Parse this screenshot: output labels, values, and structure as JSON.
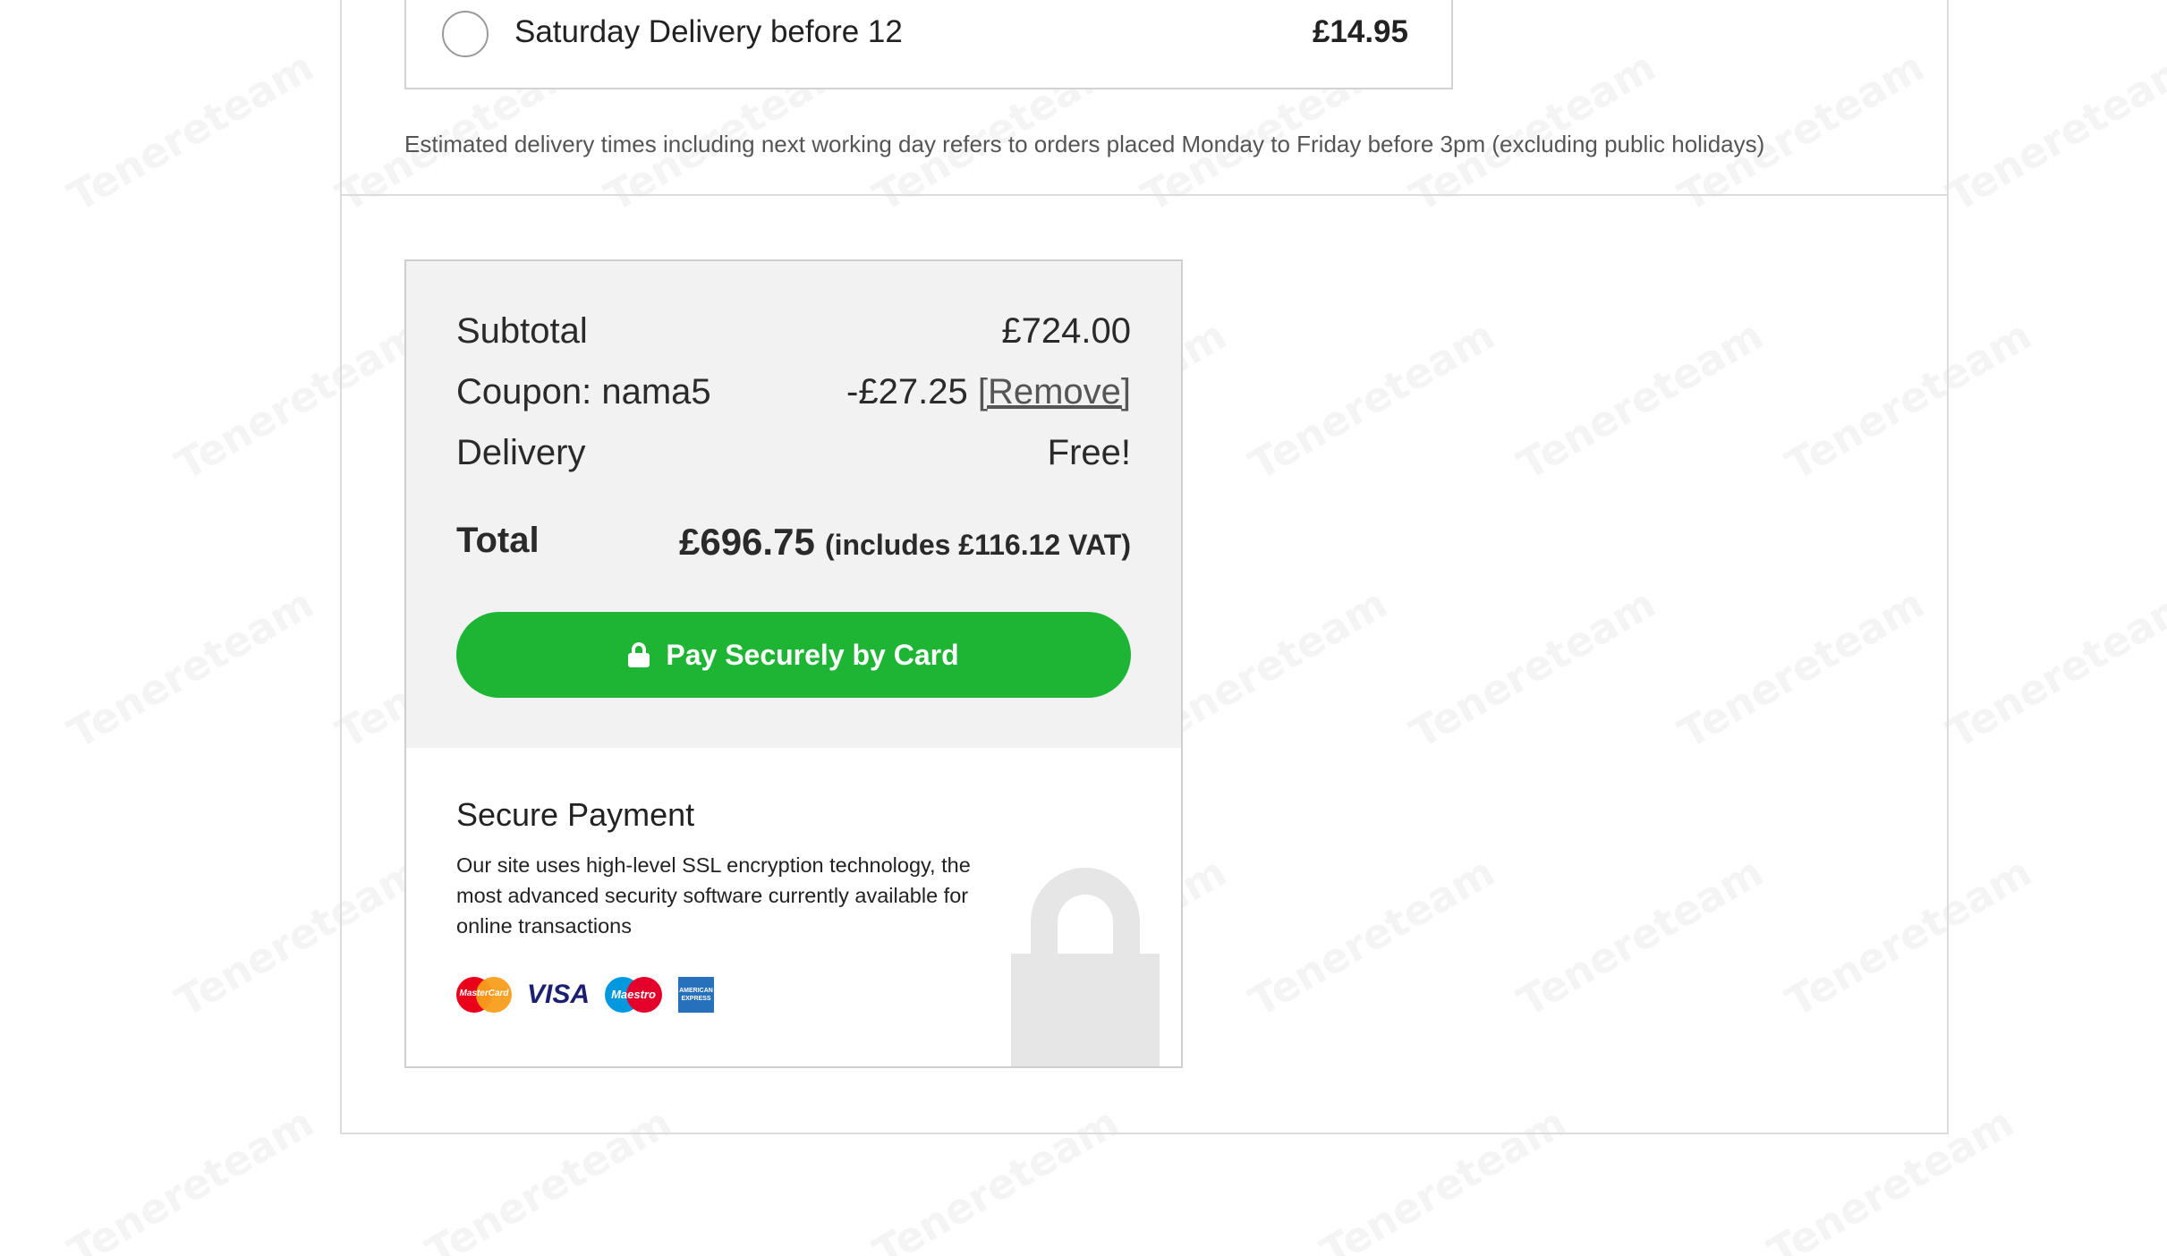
{
  "watermark_text": "Tenereteam",
  "shipping_option": {
    "label": "Saturday Delivery before 12",
    "price": "£14.95",
    "selected": false
  },
  "delivery_note": "Estimated delivery times including next working day refers to orders placed Monday to Friday before 3pm (excluding public holidays)",
  "summary": {
    "subtotal_label": "Subtotal",
    "subtotal_value": "£724.00",
    "coupon_label": "Coupon: nama5",
    "coupon_value": "-£27.25",
    "remove_label": "[Remove]",
    "delivery_label": "Delivery",
    "delivery_value": "Free!",
    "total_label": "Total",
    "total_value": "£696.75",
    "vat_note": "(includes £116.12 VAT)",
    "pay_button_label": "Pay Securely by Card"
  },
  "secure_payment": {
    "title": "Secure Payment",
    "description": "Our site uses high-level SSL encryption technology, the most advanced security software currently available for online transactions",
    "cards": [
      {
        "icon": "mastercard-icon",
        "text": "MasterCard"
      },
      {
        "icon": "visa-icon",
        "text": "VISA"
      },
      {
        "icon": "maestro-icon",
        "text": "Maestro"
      },
      {
        "icon": "amex-icon",
        "text": "AMERICAN EXPRESS"
      }
    ]
  },
  "colors": {
    "pay_button": "#1fb534",
    "summary_background": "#f2f2f2",
    "border": "#dcdcdc"
  }
}
